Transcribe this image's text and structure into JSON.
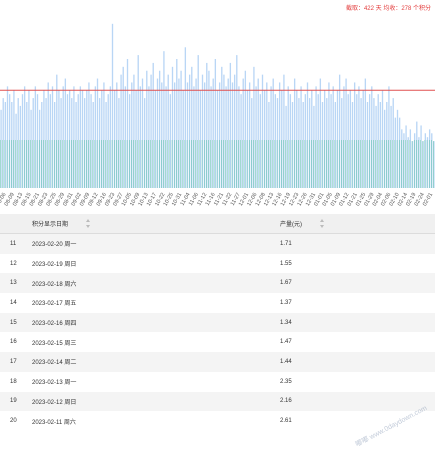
{
  "summary": "截取：422 天 均收：278 个积分",
  "chart_data": {
    "type": "bar",
    "x": [
      "08-06",
      "08-09",
      "08-13",
      "08-15",
      "08-21",
      "08-23",
      "08-25",
      "08-29",
      "08-31",
      "09-02",
      "09-09",
      "09-12",
      "09-16",
      "09-23",
      "09-27",
      "10-05",
      "10-09",
      "10-13",
      "10-17",
      "10-22",
      "10-25",
      "10-31",
      "11-04",
      "11-06",
      "11-12",
      "11-16",
      "11-21",
      "11-22",
      "11-27",
      "12-01",
      "12-06",
      "12-08",
      "12-13",
      "12-16",
      "12-19",
      "12-23",
      "12-26",
      "12-31",
      "01-01",
      "01-05",
      "01-09",
      "01-12",
      "01-21",
      "01-25",
      "01-29",
      "02-04",
      "02-06",
      "02-10",
      "02-14",
      "02-19",
      "02-24",
      "02-01"
    ],
    "values": [
      2.0,
      2.3,
      2.2,
      2.6,
      2.4,
      2.2,
      2.5,
      1.9,
      2.3,
      2.1,
      2.4,
      2.6,
      2.2,
      2.5,
      2.0,
      2.3,
      2.6,
      2.4,
      2.0,
      2.2,
      2.5,
      2.3,
      2.7,
      2.4,
      2.6,
      2.2,
      2.9,
      2.5,
      2.3,
      2.6,
      2.8,
      2.4,
      2.5,
      2.3,
      2.6,
      2.2,
      2.4,
      2.6,
      2.5,
      2.3,
      2.5,
      2.7,
      2.4,
      2.2,
      2.6,
      2.8,
      2.3,
      2.5,
      2.7,
      2.2,
      2.4,
      2.6,
      4.2,
      2.5,
      2.7,
      2.3,
      2.9,
      3.1,
      2.6,
      3.3,
      2.4,
      2.7,
      2.9,
      2.5,
      3.4,
      2.6,
      2.8,
      2.3,
      3.0,
      2.6,
      2.9,
      3.2,
      2.5,
      2.8,
      3.0,
      2.7,
      3.5,
      2.6,
      2.9,
      2.4,
      3.1,
      2.7,
      3.3,
      2.8,
      3.0,
      2.5,
      3.6,
      2.7,
      2.9,
      3.1,
      2.6,
      2.8,
      3.4,
      2.5,
      2.9,
      2.7,
      3.2,
      3.0,
      2.6,
      2.8,
      3.3,
      2.5,
      2.7,
      3.1,
      2.9,
      2.6,
      2.8,
      3.2,
      2.7,
      2.9,
      3.4,
      2.6,
      2.4,
      2.8,
      3.0,
      2.5,
      2.7,
      2.3,
      3.1,
      2.6,
      2.8,
      2.4,
      2.9,
      2.5,
      2.7,
      2.2,
      2.6,
      2.8,
      2.4,
      2.3,
      2.7,
      2.5,
      2.9,
      2.1,
      2.6,
      2.4,
      2.2,
      2.8,
      2.5,
      2.3,
      2.6,
      2.2,
      2.4,
      2.7,
      2.3,
      2.5,
      2.1,
      2.6,
      2.4,
      2.8,
      2.2,
      2.5,
      2.3,
      2.7,
      2.4,
      2.6,
      2.2,
      2.5,
      2.9,
      2.3,
      2.6,
      2.8,
      2.4,
      2.5,
      2.2,
      2.7,
      2.4,
      2.6,
      2.3,
      2.5,
      2.8,
      2.2,
      2.4,
      2.6,
      2.3,
      2.1,
      2.4,
      2.2,
      2.5,
      2.0,
      2.2,
      2.6,
      2.1,
      2.3,
      1.8,
      2.0,
      1.8,
      1.5,
      1.4,
      1.6,
      1.3,
      1.5,
      1.2,
      1.4,
      1.7,
      1.3,
      1.6,
      1.2,
      1.4,
      1.3,
      1.5,
      1.4,
      1.2
    ],
    "ylim": [
      0,
      4.4
    ],
    "reference_line": 2.5,
    "bar_color": "#b9d6f5",
    "reference_color": "#e05050",
    "baseline_color": "#3cb98c"
  },
  "table": {
    "headers": [
      "",
      "积分显示日期",
      "产量(元)"
    ],
    "rows": [
      {
        "idx": "11",
        "date": "2023-02-20 周一",
        "value": "1.71"
      },
      {
        "idx": "12",
        "date": "2023-02-19 周日",
        "value": "1.55"
      },
      {
        "idx": "13",
        "date": "2023-02-18 周六",
        "value": "1.67"
      },
      {
        "idx": "14",
        "date": "2023-02-17 周五",
        "value": "1.37"
      },
      {
        "idx": "15",
        "date": "2023-02-16 周四",
        "value": "1.34"
      },
      {
        "idx": "16",
        "date": "2023-02-15 周三",
        "value": "1.47"
      },
      {
        "idx": "17",
        "date": "2023-02-14 周二",
        "value": "1.44"
      },
      {
        "idx": "18",
        "date": "2023-02-13 周一",
        "value": "2.35"
      },
      {
        "idx": "19",
        "date": "2023-02-12 周日",
        "value": "2.16"
      },
      {
        "idx": "20",
        "date": "2023-02-11 周六",
        "value": "2.61"
      }
    ]
  },
  "watermark": "嘟嘟 www.0daydown.com"
}
